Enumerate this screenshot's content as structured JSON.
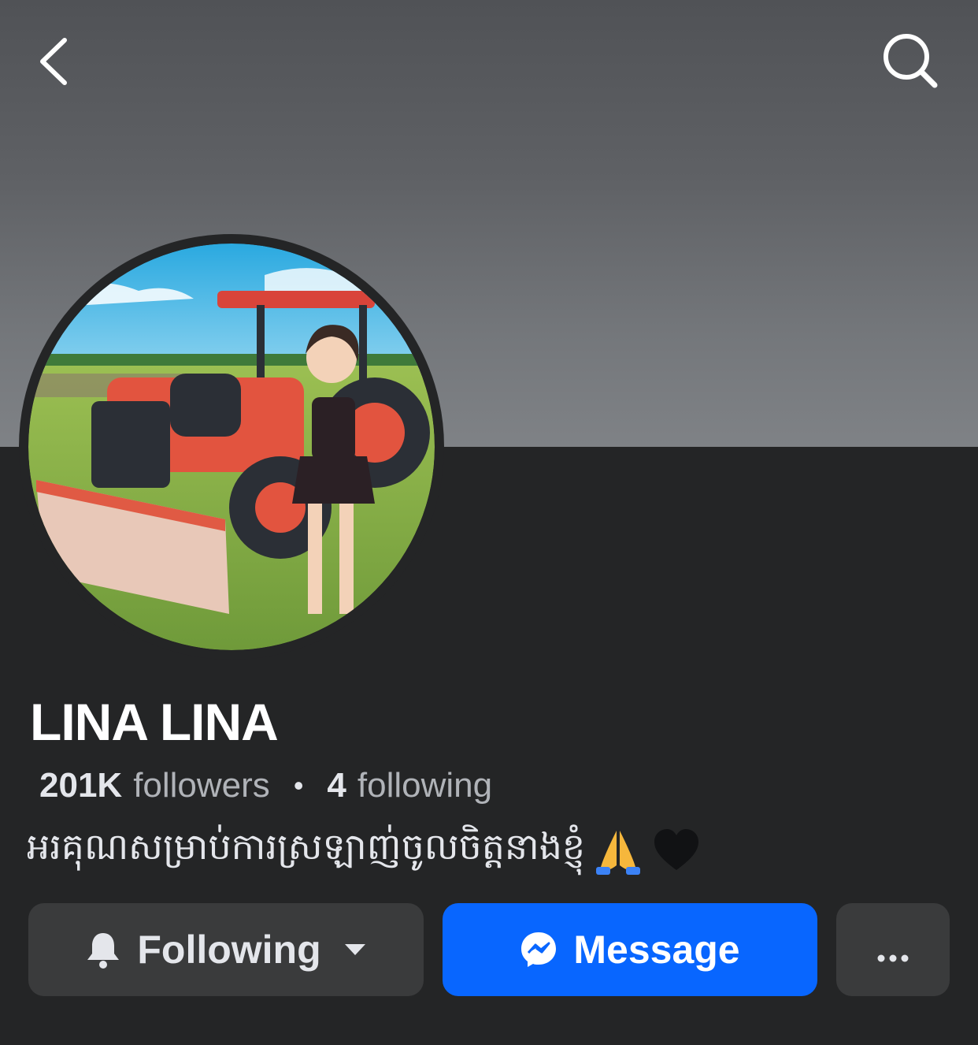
{
  "profile": {
    "name": "LINA LINA",
    "followers_count": "201K",
    "followers_label": "followers",
    "separator": "•",
    "following_count": "4",
    "following_label": "following",
    "bio": "អរគុណសម្រាប់ការស្រឡាញ់ចូលចិត្តនាងខ្ញុំ"
  },
  "actions": {
    "following_label": "Following",
    "message_label": "Message",
    "more_label": "..."
  },
  "icons": {
    "back": "chevron-left-icon",
    "search": "search-icon",
    "bell": "bell-icon",
    "caret": "caret-down-icon",
    "messenger": "messenger-icon",
    "more": "more-dots-icon",
    "pray": "folded-hands-emoji",
    "heart": "black-heart-emoji"
  },
  "colors": {
    "background": "#242526",
    "button_secondary": "#3a3b3c",
    "button_primary": "#0866ff",
    "text_primary": "#e4e6eb",
    "text_secondary": "#b0b3b8"
  }
}
